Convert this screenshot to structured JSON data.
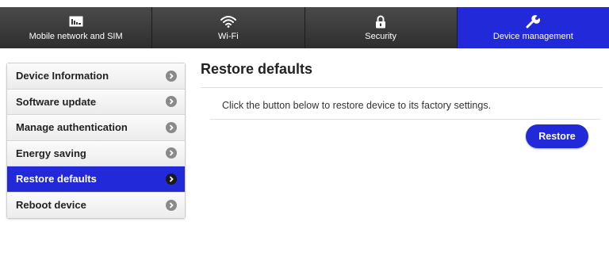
{
  "topnav": {
    "tabs": [
      {
        "label": "Mobile network and SIM",
        "icon": "sim-card-icon"
      },
      {
        "label": "Wi-Fi",
        "icon": "wifi-icon"
      },
      {
        "label": "Security",
        "icon": "lock-icon"
      },
      {
        "label": "Device management",
        "icon": "wrench-icon",
        "active": true
      }
    ]
  },
  "sidebar": {
    "items": [
      {
        "label": "Device Information"
      },
      {
        "label": "Software update"
      },
      {
        "label": "Manage authentication"
      },
      {
        "label": "Energy saving"
      },
      {
        "label": "Restore defaults",
        "active": true
      },
      {
        "label": "Reboot device"
      }
    ]
  },
  "main": {
    "title": "Restore defaults",
    "description": "Click the button below to restore device to its factory settings.",
    "restore_label": "Restore"
  },
  "colors": {
    "accent": "#2229d8",
    "nav_bg": "#3a3a3a"
  }
}
